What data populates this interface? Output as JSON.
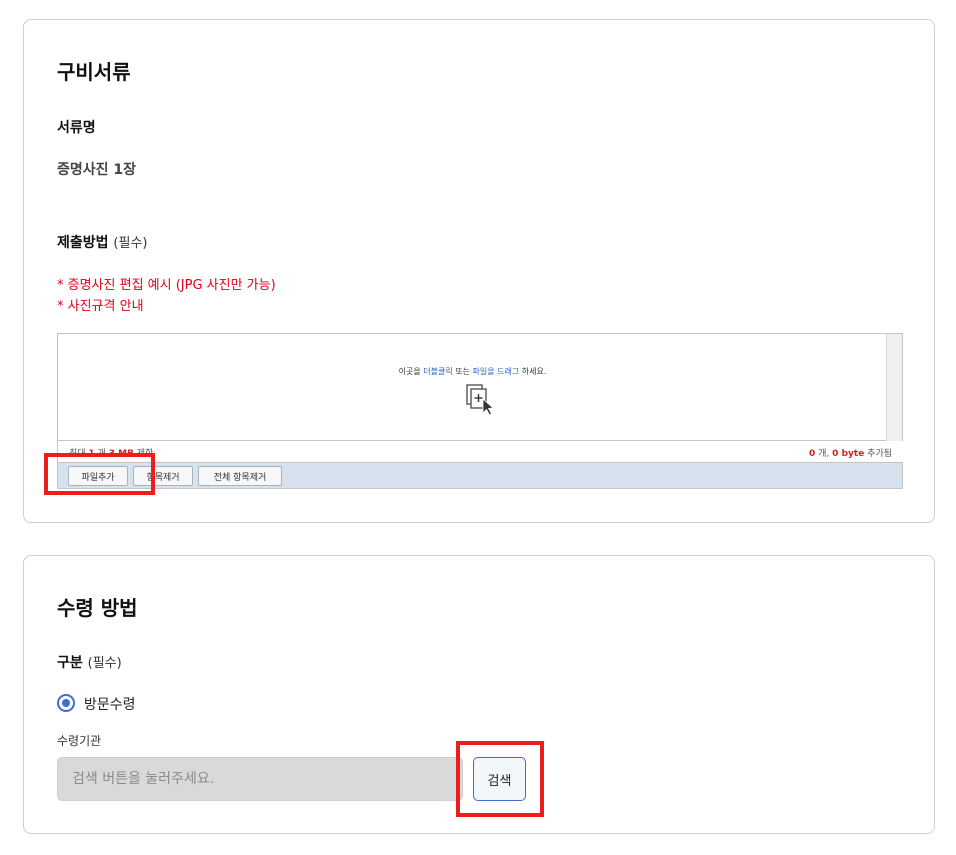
{
  "docs_section": {
    "title": "구비서류",
    "doc_name_label": "서류명",
    "doc_name_value": "증명사진 1장",
    "submit_label": "제출방법",
    "required_tag": "(필수)",
    "notes": [
      "* 증명사진 편집 예시 (JPG 사진만 가능)",
      "* 사진규격 안내"
    ],
    "uploader": {
      "hint_before": "이곳을 ",
      "hint_link1": "더블클릭",
      "hint_mid": " 또는 ",
      "hint_link2": "파일을 드래그",
      "hint_after": " 하세요.",
      "limit_prefix": "최대 ",
      "limit_count": "1",
      "limit_mid": " 개 ",
      "limit_size": "3 MB",
      "limit_suffix": " 제한",
      "added_count": "0",
      "added_mid": " 개, ",
      "added_size": "0 byte",
      "added_suffix": " 추가됨",
      "buttons": {
        "add": "파일추가",
        "remove": "항목제거",
        "remove_all": "전체 항목제거"
      },
      "drop_icon": "add-document-icon"
    }
  },
  "receive_section": {
    "title": "수령 방법",
    "type_label": "구분",
    "required_tag": "(필수)",
    "radio_option": "방문수령",
    "agency_label": "수령기관",
    "search_placeholder": "검색 버튼을 눌러주세요.",
    "search_button": "검색"
  },
  "colors": {
    "accent_blue": "#3b6fd6",
    "required_red": "#e0001b",
    "highlight_red": "#ee1c1c"
  }
}
